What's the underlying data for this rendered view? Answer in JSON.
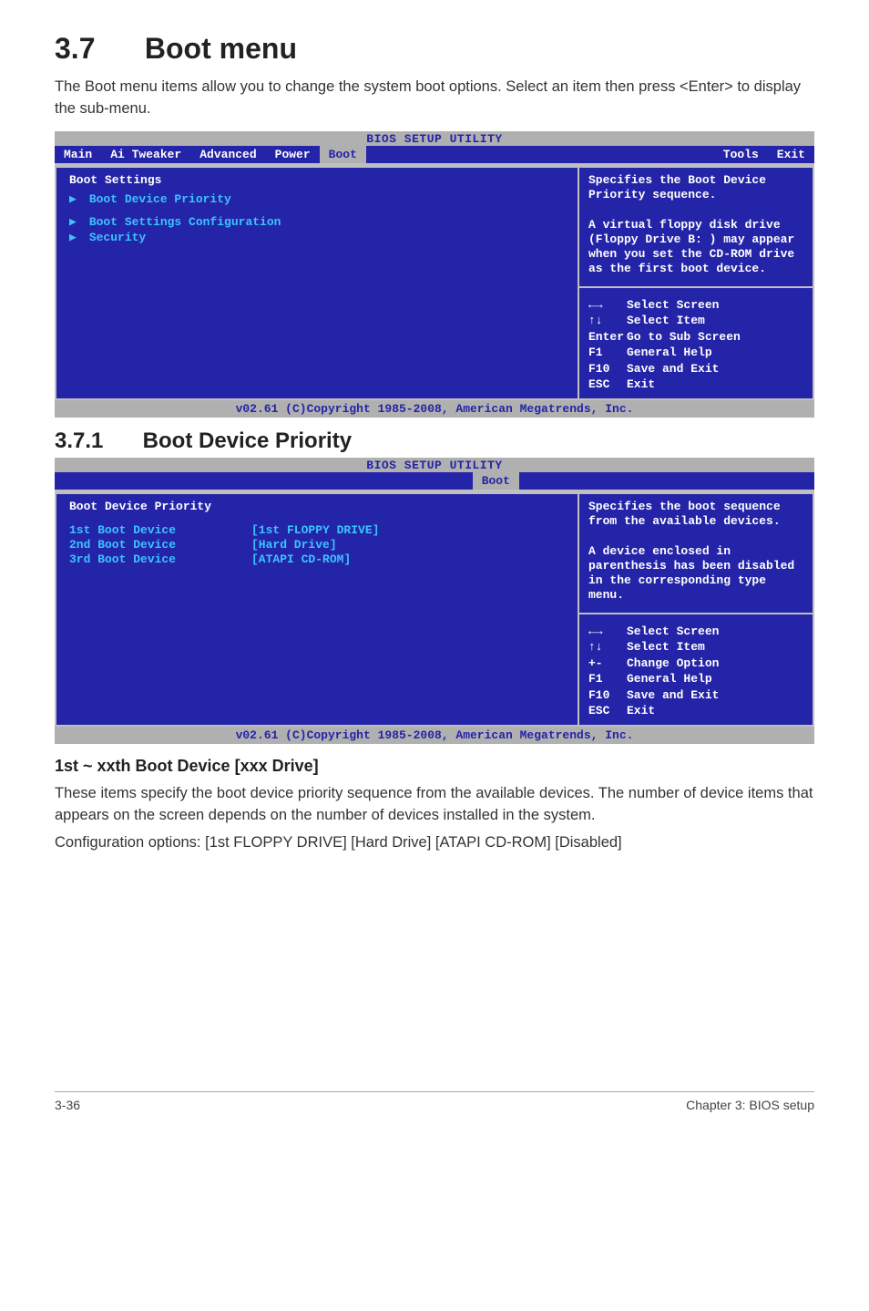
{
  "section": {
    "num": "3.7",
    "title": "Boot menu"
  },
  "intro": "The Boot menu items allow you to change the system boot options. Select an item then press <Enter> to display the sub-menu.",
  "bios1": {
    "title": "BIOS SETUP UTILITY",
    "tabs": [
      "Main",
      "Ai Tweaker",
      "Advanced",
      "Power",
      "Boot",
      "Tools",
      "Exit"
    ],
    "active_tab": "Boot",
    "left_heading": "Boot Settings",
    "items": [
      "Boot Device Priority",
      "Boot Settings Configuration",
      "Security"
    ],
    "help_text": "Specifies the Boot Device Priority sequence.\n\nA virtual floppy disk drive (Floppy Drive B: ) may appear when you set the CD-ROM drive as the first boot device.",
    "keys": [
      {
        "sym": "←→",
        "label": "Select Screen"
      },
      {
        "sym": "↑↓",
        "label": "Select Item"
      },
      {
        "sym": "Enter",
        "label": "Go to Sub Screen"
      },
      {
        "sym": "F1",
        "label": "General Help"
      },
      {
        "sym": "F10",
        "label": "Save and Exit"
      },
      {
        "sym": "ESC",
        "label": "Exit"
      }
    ],
    "copyright": "v02.61 (C)Copyright 1985-2008, American Megatrends, Inc."
  },
  "subsection": {
    "num": "3.7.1",
    "title": "Boot Device Priority"
  },
  "bios2": {
    "title": "BIOS SETUP UTILITY",
    "tab": "Boot",
    "left_heading": "Boot Device Priority",
    "rows": [
      {
        "label": "1st Boot Device",
        "value": "[1st FLOPPY DRIVE]"
      },
      {
        "label": "2nd Boot Device",
        "value": "[Hard Drive]"
      },
      {
        "label": "3rd Boot Device",
        "value": "[ATAPI CD-ROM]"
      }
    ],
    "help_text": "Specifies the boot sequence from the available devices.\n\nA device enclosed in parenthesis has been disabled in the corresponding type menu.",
    "keys": [
      {
        "sym": "←→",
        "label": "Select Screen"
      },
      {
        "sym": "↑↓",
        "label": "Select Item"
      },
      {
        "sym": "+-",
        "label": "Change Option"
      },
      {
        "sym": "F1",
        "label": "General Help"
      },
      {
        "sym": "F10",
        "label": "Save and Exit"
      },
      {
        "sym": "ESC",
        "label": "Exit"
      }
    ],
    "copyright": "v02.61 (C)Copyright 1985-2008, American Megatrends, Inc."
  },
  "sub_heading": "1st ~ xxth Boot Device [xxx Drive]",
  "body1": "These items specify the boot device priority sequence from the available devices. The number of device items that appears on the screen depends on the number of devices installed in the system.",
  "body2": "Configuration options: [1st FLOPPY DRIVE] [Hard Drive] [ATAPI CD-ROM] [Disabled]",
  "footer": {
    "left": "3-36",
    "right": "Chapter 3: BIOS setup"
  }
}
